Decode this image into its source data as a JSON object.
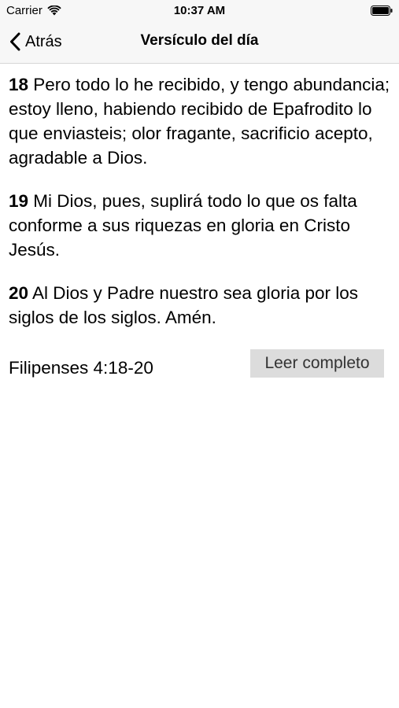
{
  "status_bar": {
    "carrier": "Carrier",
    "time": "10:37 AM"
  },
  "nav": {
    "back_label": "Atrás",
    "title": "Versículo del día"
  },
  "verses": [
    {
      "number": "18",
      "text": " Pero todo lo he recibido, y tengo abundancia; estoy lleno, habiendo recibido de Epafrodito lo que enviasteis; olor fragante, sacrificio acepto, agradable a Dios."
    },
    {
      "number": "19",
      "text": " Mi Dios, pues, suplirá todo lo que os falta conforme a sus riquezas en gloria en Cristo Jesús."
    },
    {
      "number": "20",
      "text": " Al Dios y Padre nuestro sea gloria por los siglos de los siglos. Amén."
    }
  ],
  "reference": "Filipenses 4:18-20",
  "read_button_label": "Leer completo",
  "icons": {
    "wifi": "wifi-icon",
    "battery": "battery-icon",
    "back": "chevron-left-icon"
  }
}
